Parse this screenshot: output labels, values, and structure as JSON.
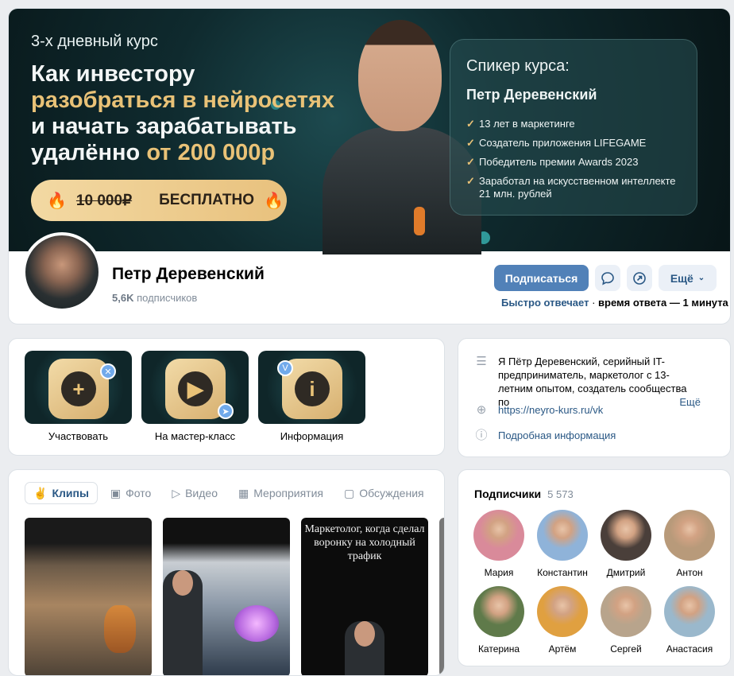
{
  "cover": {
    "kicker": "3-х дневный курс",
    "title_line1": "Как инвестору",
    "title_line2": "разобраться в нейросетях",
    "title_line3": "и начать зарабатывать",
    "title_line4_start": "удалённо",
    "title_line4_accent": "от 200 000р",
    "price_old": "10 000₽",
    "price_new": "БЕСПЛАТНО",
    "speaker_label": "Спикер курса:",
    "speaker_name": "Петр Деревенский",
    "speaker_points": [
      "13 лет в маркетинге",
      "Создатель приложения LIFEGAME",
      "Победитель премии Awards 2023",
      "Заработал на искусственном интеллекте 21 млн. рублей"
    ]
  },
  "profile": {
    "name": "Петр Деревенский",
    "subs_count": "5,6K",
    "subs_label": "подписчиков",
    "subscribe_label": "Подписаться",
    "more_label": "Ещё",
    "reply_fast": "Быстро отвечает",
    "reply_sep": " · ",
    "reply_time": "время ответа — 1 минута"
  },
  "apps": [
    {
      "label": "Участвовать",
      "glyph": "+",
      "badge": "✕",
      "icon": "plus-icon"
    },
    {
      "label": "На мастер-класс",
      "glyph": "▶",
      "badge": "➤",
      "icon": "play-icon"
    },
    {
      "label": "Информация",
      "glyph": "i",
      "badge": "V",
      "icon": "info-icon"
    }
  ],
  "about": {
    "description": "Я Пётр Деревенский, серийный IT-предприниматель, маркетолог с 13-летним опытом, создатель сообщества по",
    "more": "Ещё",
    "link": "https://neyro-kurs.ru/vk",
    "details": "Подробная информация"
  },
  "tabs": [
    {
      "label": "Клипы",
      "icon": "clips-icon",
      "glyph": "✌"
    },
    {
      "label": "Фото",
      "icon": "photo-icon",
      "glyph": "▣"
    },
    {
      "label": "Видео",
      "icon": "video-icon",
      "glyph": "▷"
    },
    {
      "label": "Мероприятия",
      "icon": "calendar-icon",
      "glyph": "▦"
    },
    {
      "label": "Обсуждения",
      "icon": "discussion-icon",
      "glyph": "▢"
    }
  ],
  "clips": {
    "clip3_caption": "Маркетолог, когда сделал воронку на холодный трафик"
  },
  "subscribers": {
    "title": "Подписчики",
    "count": "5 573",
    "people": [
      {
        "name": "Мария",
        "color": "#d98a9a"
      },
      {
        "name": "Константин",
        "color": "#8fb3d9"
      },
      {
        "name": "Дмитрий",
        "color": "#4a3f3a"
      },
      {
        "name": "Антон",
        "color": "#b89a7a"
      },
      {
        "name": "Катерина",
        "color": "#5f7a4a"
      },
      {
        "name": "Артём",
        "color": "#e0a040"
      },
      {
        "name": "Сергей",
        "color": "#b8a48c"
      },
      {
        "name": "Анастасия",
        "color": "#9ab8cc"
      }
    ]
  }
}
